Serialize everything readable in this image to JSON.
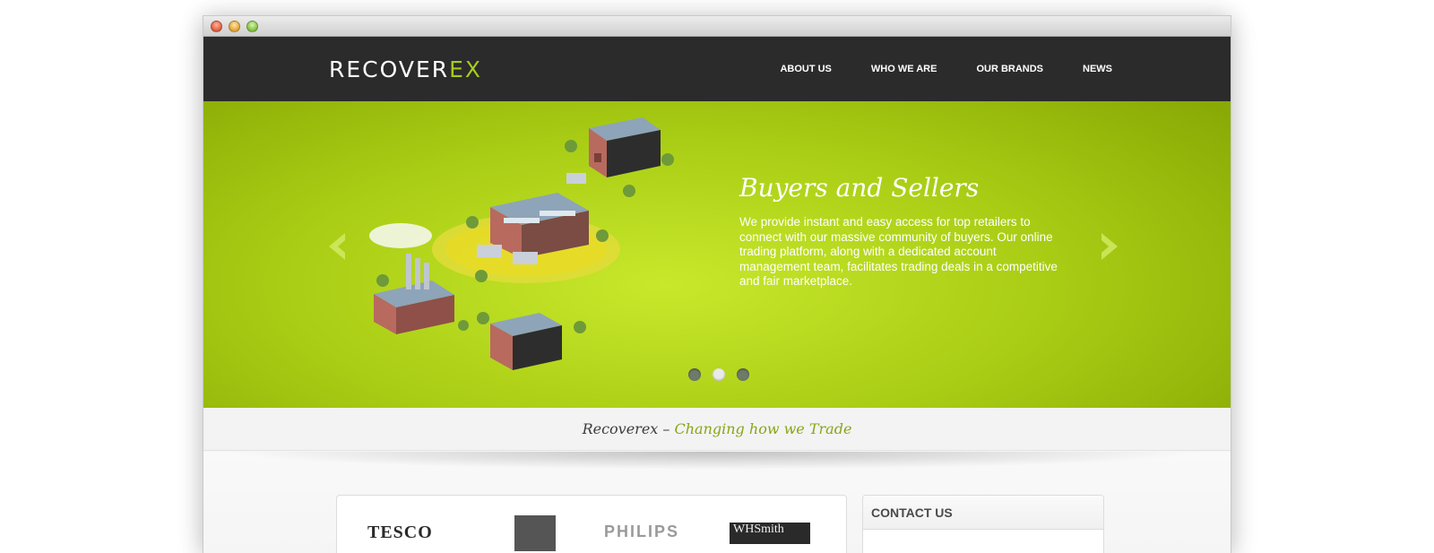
{
  "logo": {
    "main": "RECOVER",
    "accent": "EX"
  },
  "nav": {
    "items": [
      {
        "label": "ABOUT US"
      },
      {
        "label": "WHO WE ARE"
      },
      {
        "label": "OUR BRANDS"
      },
      {
        "label": "NEWS"
      }
    ]
  },
  "hero": {
    "title": "Buyers and Sellers",
    "body": "We provide instant and easy access for top retailers to connect with our massive community of buyers. Our online trading platform, along with a dedicated account management team, facilitates trading deals in a competitive and fair marketplace.",
    "slides": {
      "count": 3,
      "active_index": 1
    }
  },
  "tagline": {
    "brand": "Recoverex",
    "separator": " – ",
    "slogan": "Changing how we Trade"
  },
  "brands": {
    "tesco": "TESCO",
    "philips": "PHILIPS",
    "whsmith": "WHSmith"
  },
  "contact": {
    "title": "CONTACT US"
  },
  "colors": {
    "accent": "#a6cc1c",
    "header_bg": "#2b2b2b",
    "hero_green": "#a8cc14",
    "slogan_green": "#86a617"
  }
}
